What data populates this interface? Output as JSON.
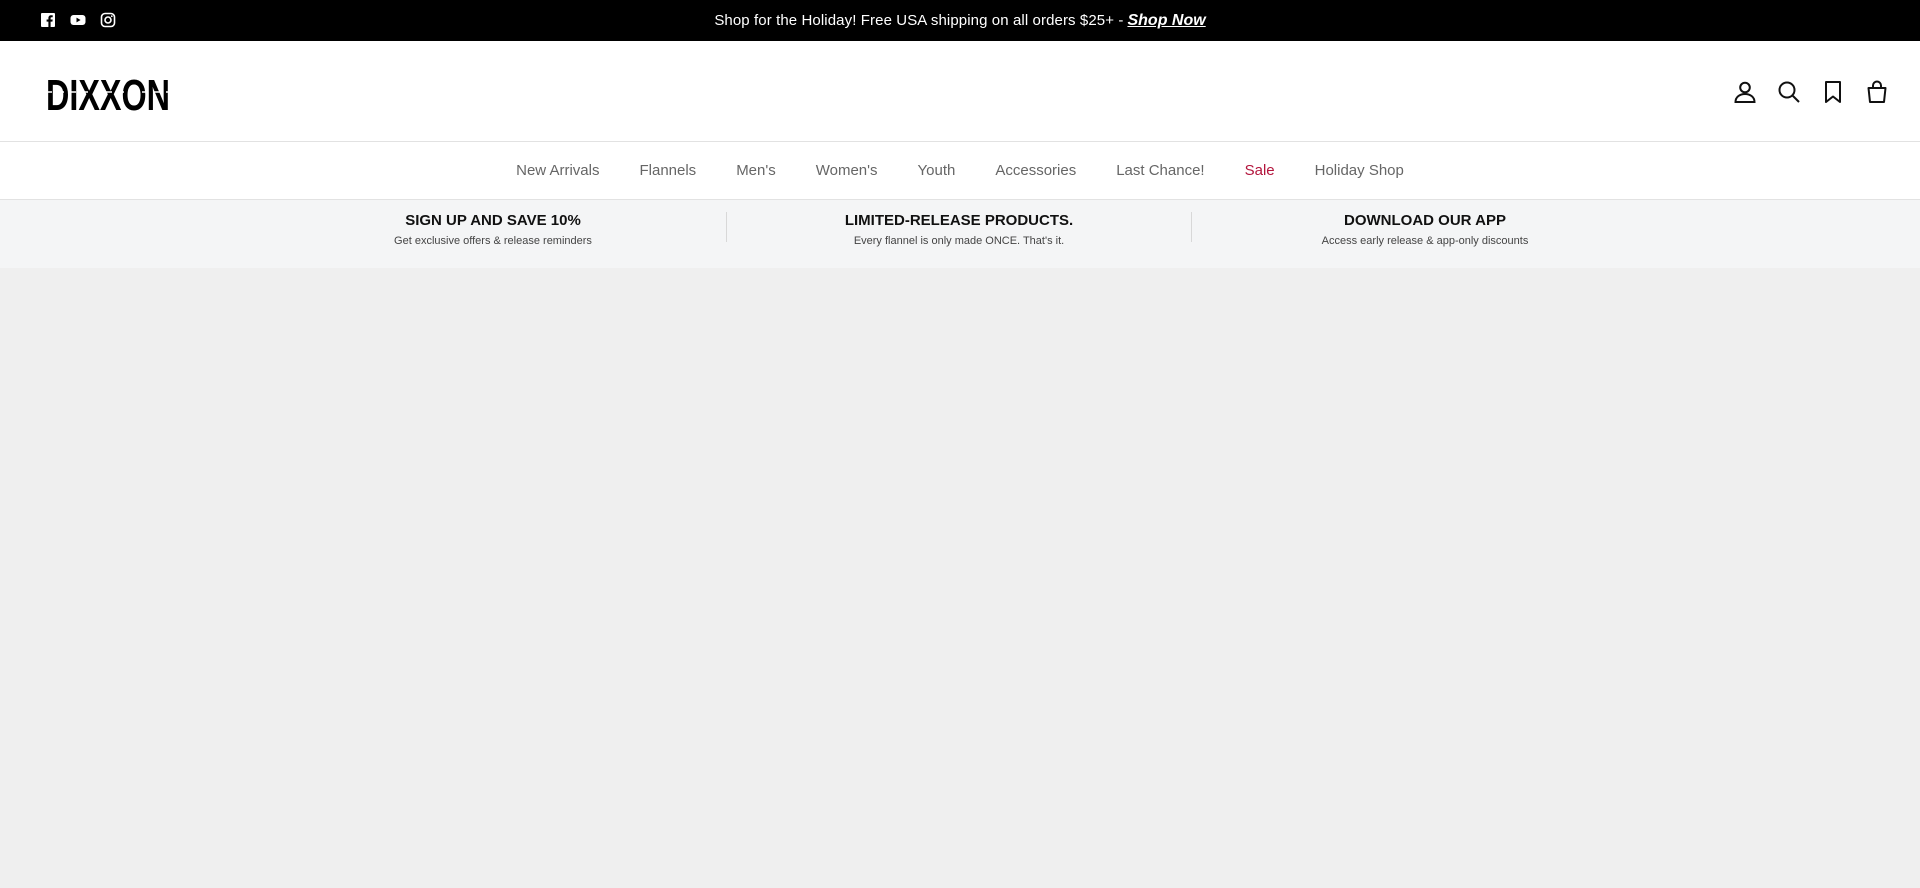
{
  "announcement": {
    "text": "Shop for the Holiday! Free USA shipping on all orders $25+ -",
    "link": "Shop Now"
  },
  "socials": [
    {
      "icon": "facebook-icon"
    },
    {
      "icon": "youtube-icon"
    },
    {
      "icon": "instagram-icon"
    }
  ],
  "header": {
    "logo": "DIXXON",
    "icons": [
      "account-icon",
      "search-icon",
      "wishlist-icon",
      "cart-icon"
    ]
  },
  "nav": {
    "items": [
      {
        "label": "New Arrivals"
      },
      {
        "label": "Flannels"
      },
      {
        "label": "Men's"
      },
      {
        "label": "Women's"
      },
      {
        "label": "Youth"
      },
      {
        "label": "Accessories"
      },
      {
        "label": "Last Chance!"
      },
      {
        "label": "Sale"
      },
      {
        "label": "Holiday Shop"
      }
    ],
    "sale_color": "#b3153d"
  },
  "usp": [
    {
      "title": "SIGN UP AND SAVE 10%",
      "subtitle": "Get exclusive offers & release reminders"
    },
    {
      "title": "LIMITED-RELEASE PRODUCTS.",
      "subtitle": "Every flannel is only made ONCE. That's it."
    },
    {
      "title": "DOWNLOAD OUR APP",
      "subtitle": "Access early release & app-only discounts"
    }
  ]
}
